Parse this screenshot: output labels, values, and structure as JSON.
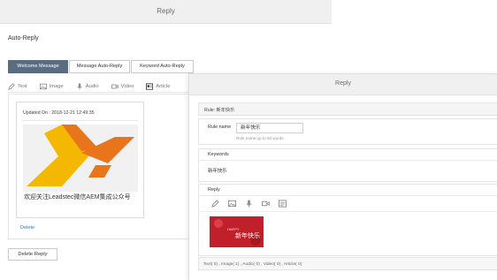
{
  "back_panel": {
    "title": "Reply",
    "page_title": "Auto-Reply",
    "tabs": [
      {
        "label": "Welcome Message",
        "active": true
      },
      {
        "label": "Message Auto-Reply",
        "active": false
      },
      {
        "label": "Keyword Auto-Reply",
        "active": false
      }
    ],
    "toolbar": [
      {
        "label": "Text",
        "icon": "pencil-icon"
      },
      {
        "label": "Image",
        "icon": "image-icon"
      },
      {
        "label": "Audio",
        "icon": "microphone-icon"
      },
      {
        "label": "Video",
        "icon": "video-icon"
      },
      {
        "label": "Article",
        "icon": "article-icon"
      }
    ],
    "card": {
      "updated": "Updated On : 2018-12-21 12:49:35",
      "caption": "欢迎关注Leadstec微信AEM集成公众号"
    },
    "delete_link": "Delete",
    "delete_reply_button": "Delete Reply"
  },
  "front_panel": {
    "title": "Reply",
    "rule_label": "Rule: 新年快乐",
    "rule_name_label": "Rule name",
    "rule_name_value": "新年快乐",
    "rule_name_hint": "Rule name up to 60 words",
    "keywords_label": "Keywords",
    "keywords_value": "新年快乐",
    "reply_label": "Reply",
    "reply_tools": [
      "pencil-icon",
      "image-icon",
      "microphone-icon",
      "video-icon",
      "article-icon"
    ],
    "image_text": {
      "line1": "HAPPY",
      "line2": "新年快乐"
    },
    "counts": "Text( 0) , Image( 1) , Audio( 0) , Video( 0) , Article( 0)"
  },
  "colors": {
    "tab_active_bg": "#5a6d80",
    "link": "#3a74b8",
    "logo_orange": "#e8741c",
    "logo_yellow": "#f5b800",
    "poster_red": "#c0202a"
  }
}
